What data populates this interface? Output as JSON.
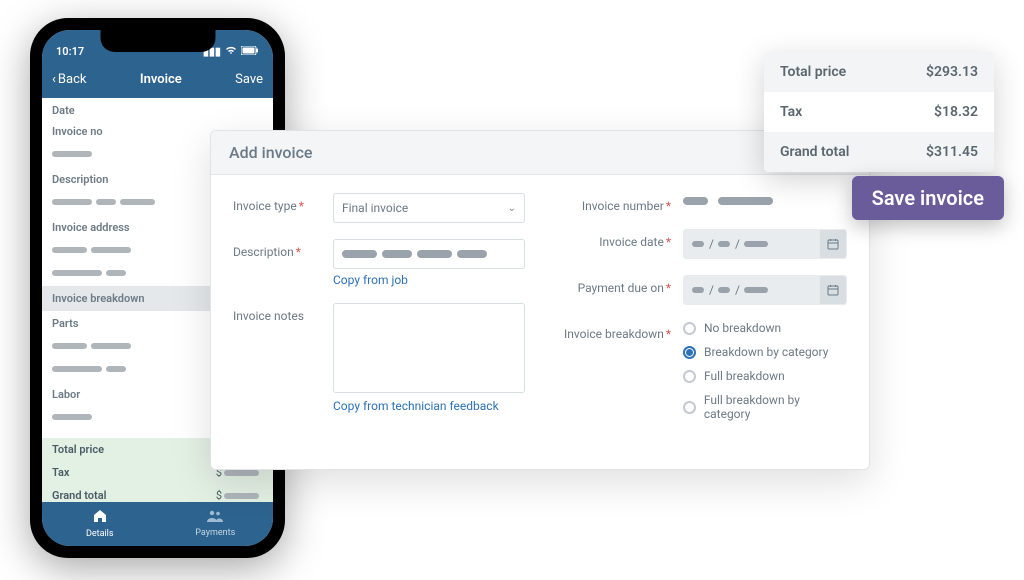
{
  "phone": {
    "status_time": "10:17",
    "back_label": "Back",
    "title": "Invoice",
    "save_label": "Save",
    "fields": {
      "date": "Date",
      "invoice_no": "Invoice no",
      "description": "Description",
      "invoice_address": "Invoice address"
    },
    "breakdown_header": "Invoice breakdown",
    "parts_label": "Parts",
    "labor_label": "Labor",
    "totals": {
      "total_price": "Total price",
      "tax": "Tax",
      "grand_total": "Grand total",
      "currency": "$"
    },
    "tabs": {
      "details": "Details",
      "payments": "Payments"
    }
  },
  "form": {
    "title": "Add invoice",
    "invoice_type_label": "Invoice type",
    "invoice_type_value": "Final invoice",
    "description_label": "Description",
    "copy_from_job": "Copy from job",
    "invoice_notes_label": "Invoice notes",
    "copy_from_feedback": "Copy from technician feedback",
    "invoice_number_label": "Invoice number",
    "invoice_date_label": "Invoice date",
    "payment_due_label": "Payment due on",
    "breakdown_label": "Invoice breakdown",
    "breakdown_options": [
      "No breakdown",
      "Breakdown by category",
      "Full breakdown",
      "Full breakdown by category"
    ],
    "breakdown_selected": 1
  },
  "totals": {
    "total_price_label": "Total price",
    "total_price_value": "$293.13",
    "tax_label": "Tax",
    "tax_value": "$18.32",
    "grand_total_label": "Grand total",
    "grand_total_value": "$311.45"
  },
  "save_invoice_label": "Save invoice"
}
